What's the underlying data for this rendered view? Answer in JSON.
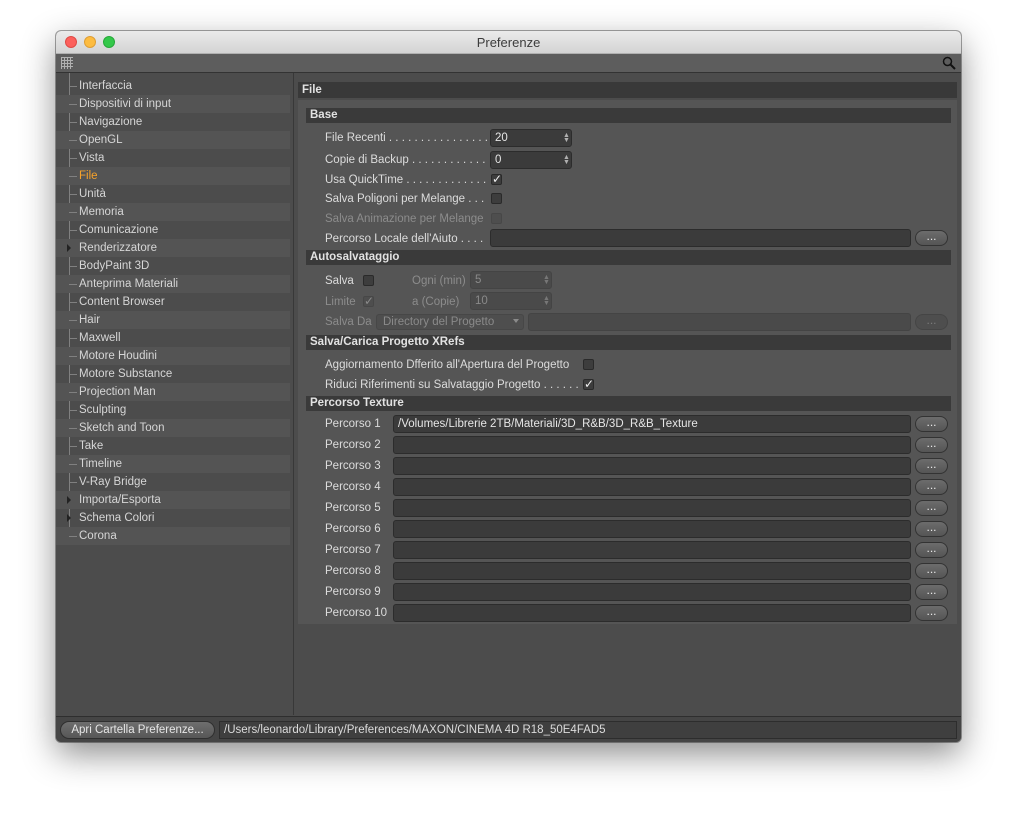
{
  "window": {
    "title": "Preferenze"
  },
  "sidebar": {
    "items": [
      {
        "label": "Interfaccia"
      },
      {
        "label": "Dispositivi di input"
      },
      {
        "label": "Navigazione"
      },
      {
        "label": "OpenGL"
      },
      {
        "label": "Vista"
      },
      {
        "label": "File",
        "active": true
      },
      {
        "label": "Unità"
      },
      {
        "label": "Memoria"
      },
      {
        "label": "Comunicazione"
      },
      {
        "label": "Renderizzatore",
        "expandable": true
      },
      {
        "label": "BodyPaint 3D"
      },
      {
        "label": "Anteprima Materiali"
      },
      {
        "label": "Content Browser"
      },
      {
        "label": "Hair"
      },
      {
        "label": "Maxwell"
      },
      {
        "label": "Motore Houdini"
      },
      {
        "label": "Motore Substance"
      },
      {
        "label": "Projection Man"
      },
      {
        "label": "Sculpting"
      },
      {
        "label": "Sketch and Toon"
      },
      {
        "label": "Take"
      },
      {
        "label": "Timeline"
      },
      {
        "label": "V-Ray Bridge"
      },
      {
        "label": "Importa/Esporta",
        "expandable": true
      },
      {
        "label": "Schema Colori",
        "expandable": true
      },
      {
        "label": "Corona"
      }
    ]
  },
  "main": {
    "heading": "File",
    "base": {
      "heading": "Base",
      "recent_label": "File Recenti . . . . . . . . . . . . . . . .",
      "recent_value": "20",
      "backup_label": "Copie di Backup . . . . . . . . . . . .",
      "backup_value": "0",
      "quicktime_label": "Usa QuickTime . . . . . . . . . . . . .",
      "quicktime_checked": true,
      "melange_poly_label": "Salva Poligoni per Melange . . .",
      "melange_poly_checked": false,
      "melange_anim_label": "Salva Animazione per Melange",
      "melange_anim_checked": false,
      "help_path_label": "Percorso Locale dell'Aiuto . . . .",
      "help_path_value": "",
      "browse_label": "..."
    },
    "autosave": {
      "heading": "Autosalvataggio",
      "save_label": "Salva",
      "save_checked": false,
      "every_label": "Ogni (min)",
      "every_value": "5",
      "limit_label": "Limite",
      "limit_checked": true,
      "copies_label": "a (Copie)",
      "copies_value": "10",
      "save_from_label": "Salva Da",
      "save_from_value": "Directory del Progetto",
      "save_from_path": "",
      "browse_label": "..."
    },
    "xrefs": {
      "heading": "Salva/Carica Progetto XRefs",
      "deferred_label": "Aggiornamento Dfferito all'Apertura del Progetto",
      "deferred_checked": false,
      "reduce_label": "Riduci Riferimenti su Salvataggio Progetto . . . . . .",
      "reduce_checked": true
    },
    "texture_paths": {
      "heading": "Percorso Texture",
      "browse_label": "...",
      "rows": [
        {
          "label": "Percorso 1",
          "value": "/Volumes/Librerie 2TB/Materiali/3D_R&B/3D_R&B_Texture"
        },
        {
          "label": "Percorso 2",
          "value": ""
        },
        {
          "label": "Percorso 3",
          "value": ""
        },
        {
          "label": "Percorso 4",
          "value": ""
        },
        {
          "label": "Percorso 5",
          "value": ""
        },
        {
          "label": "Percorso 6",
          "value": ""
        },
        {
          "label": "Percorso 7",
          "value": ""
        },
        {
          "label": "Percorso 8",
          "value": ""
        },
        {
          "label": "Percorso 9",
          "value": ""
        },
        {
          "label": "Percorso 10",
          "value": ""
        }
      ]
    }
  },
  "footer": {
    "open_folder_label": "Apri Cartella Preferenze...",
    "prefs_path": "/Users/leonardo/Library/Preferences/MAXON/CINEMA 4D R18_50E4FAD5"
  },
  "colors": {
    "active_item": "#f7a22a",
    "panel": "#4c4c4c",
    "section_header": "#3a3a3a"
  }
}
